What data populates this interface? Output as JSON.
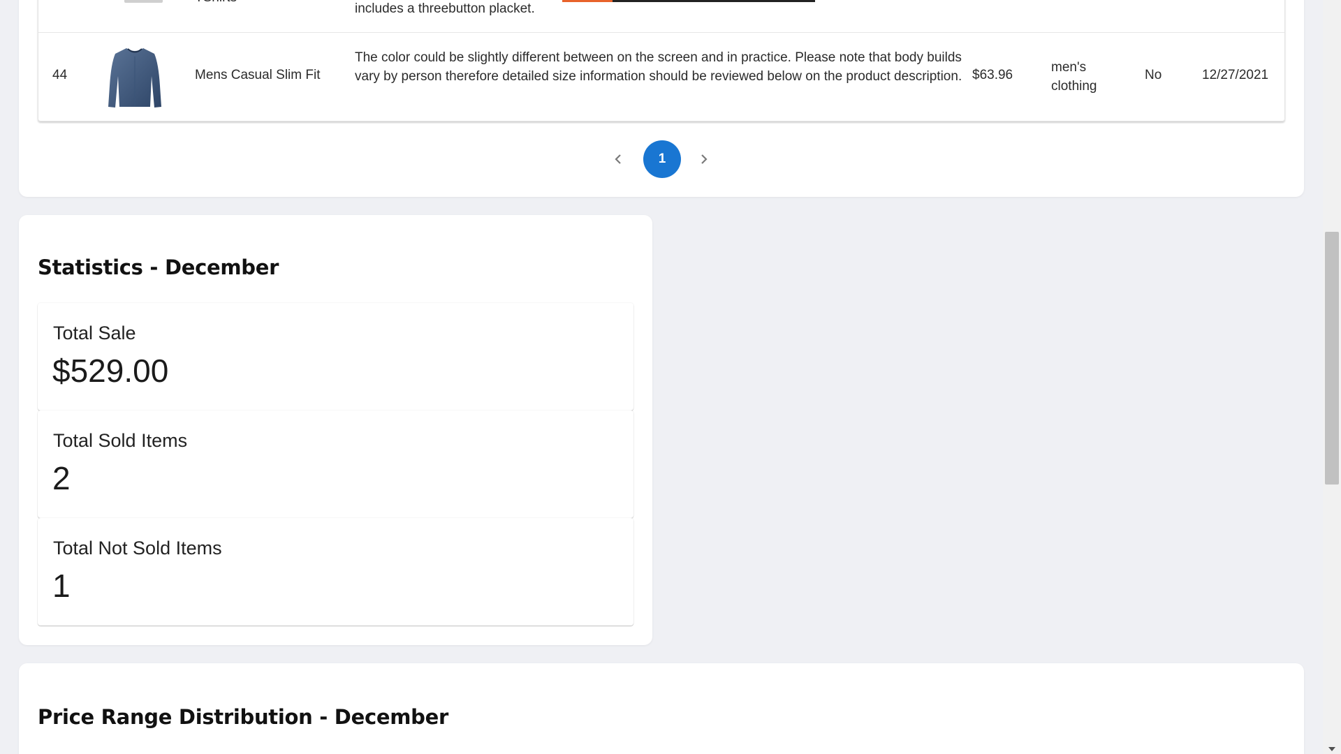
{
  "table": {
    "prev_row": {
      "title_fragment": "TShirts",
      "description_fragment": "includes a threebutton placket."
    },
    "row": {
      "id": "44",
      "title": "Mens Casual Slim Fit",
      "description": "The color could be slightly different between on the screen and in practice. Please note that body builds vary by person therefore detailed size information should be reviewed below on the product description.",
      "price": "$63.96",
      "category": "men's clothing",
      "sold": "No",
      "date": "12/27/2021",
      "image_icon": "shirt-icon"
    }
  },
  "pagination": {
    "current_page": "1",
    "prev_icon": "chevron-left-icon",
    "next_icon": "chevron-right-icon"
  },
  "statistics": {
    "heading": "Statistics - December",
    "total_sale_label": "Total Sale",
    "total_sale_value": "$529.00",
    "total_sold_label": "Total Sold Items",
    "total_sold_value": "2",
    "total_not_sold_label": "Total Not Sold Items",
    "total_not_sold_value": "1"
  },
  "price_range": {
    "heading": "Price Range Distribution - December"
  },
  "colors": {
    "accent": "#1976d2",
    "background": "#eff0f4",
    "card": "#ffffff"
  }
}
